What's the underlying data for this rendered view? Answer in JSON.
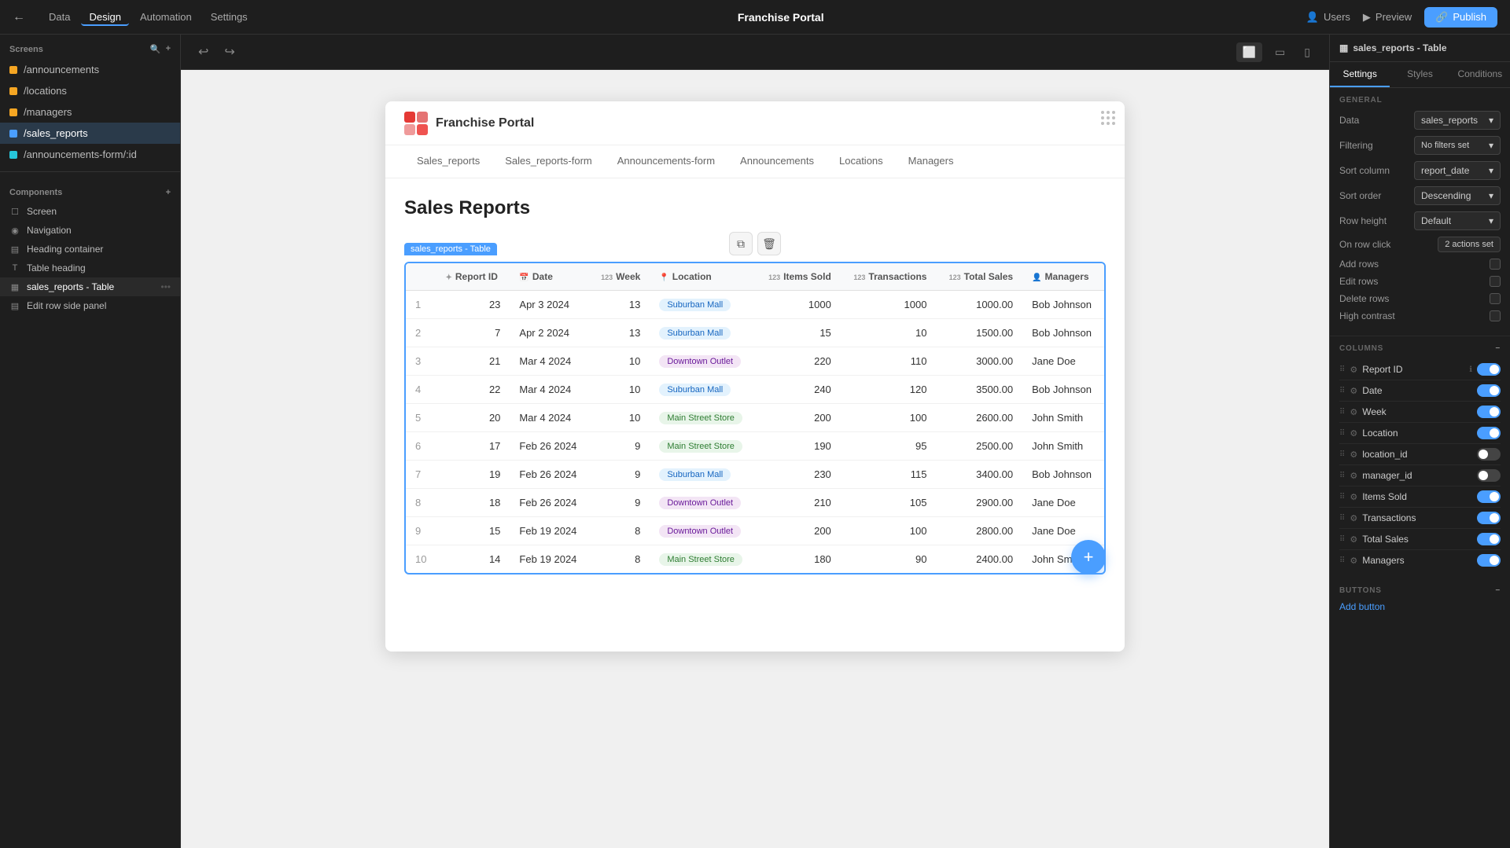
{
  "app": {
    "title": "Franchise Portal",
    "top_nav": [
      "Data",
      "Design",
      "Automation",
      "Settings"
    ],
    "active_nav": "Design",
    "topbar_right": [
      "Users",
      "Preview",
      "Publish"
    ]
  },
  "sidebar": {
    "screens_label": "Screens",
    "screens": [
      {
        "path": "/announcements",
        "color": "orange"
      },
      {
        "path": "/locations",
        "color": "orange"
      },
      {
        "path": "/managers",
        "color": "orange"
      },
      {
        "path": "/sales_reports",
        "color": "blue",
        "active": true
      },
      {
        "path": "/announcements-form/:id",
        "color": "teal"
      }
    ],
    "components_label": "Components",
    "components": [
      {
        "label": "Screen",
        "icon": "☐"
      },
      {
        "label": "Navigation",
        "icon": "◉"
      },
      {
        "label": "Heading container",
        "icon": "▤"
      },
      {
        "label": "Table heading",
        "icon": "T"
      },
      {
        "label": "sales_reports - Table",
        "icon": "▦",
        "active": true
      },
      {
        "label": "Edit row side panel",
        "icon": "▤"
      }
    ]
  },
  "canvas": {
    "undo_label": "↩",
    "redo_label": "↪",
    "devices": [
      "desktop",
      "tablet",
      "mobile"
    ]
  },
  "preview": {
    "logo_text": "Franchise Portal",
    "nav_items": [
      "Sales_reports",
      "Sales_reports-form",
      "Announcements-form",
      "Announcements",
      "Locations",
      "Managers"
    ],
    "page_title": "Sales Reports",
    "table_label": "sales_reports - Table",
    "table_columns": [
      {
        "key": "report_id",
        "label": "Report ID",
        "icon": "✦",
        "type": "id"
      },
      {
        "key": "date",
        "label": "Date",
        "icon": "📅",
        "type": "date"
      },
      {
        "key": "week",
        "label": "Week",
        "icon": "123",
        "type": "num"
      },
      {
        "key": "location",
        "label": "Location",
        "icon": "📍",
        "type": "badge"
      },
      {
        "key": "items_sold",
        "label": "Items Sold",
        "icon": "123",
        "type": "num"
      },
      {
        "key": "transactions",
        "label": "Transactions",
        "icon": "123",
        "type": "num"
      },
      {
        "key": "total_sales",
        "label": "Total Sales",
        "icon": "123",
        "type": "num"
      },
      {
        "key": "managers",
        "label": "Managers",
        "icon": "👤",
        "type": "text"
      }
    ],
    "table_rows": [
      {
        "row": "1",
        "report_id": "23",
        "date": "Apr 3 2024",
        "week": "13",
        "location": "Suburban Mall",
        "location_type": "blue",
        "items_sold": "1000",
        "transactions": "1000",
        "total_sales": "1000.00",
        "manager": "Bob Johnson"
      },
      {
        "row": "2",
        "report_id": "7",
        "date": "Apr 2 2024",
        "week": "13",
        "location": "Suburban Mall",
        "location_type": "blue",
        "items_sold": "15",
        "transactions": "10",
        "total_sales": "1500.00",
        "manager": "Bob Johnson"
      },
      {
        "row": "3",
        "report_id": "21",
        "date": "Mar 4 2024",
        "week": "10",
        "location": "Downtown Outlet",
        "location_type": "purple",
        "items_sold": "220",
        "transactions": "110",
        "total_sales": "3000.00",
        "manager": "Jane Doe"
      },
      {
        "row": "4",
        "report_id": "22",
        "date": "Mar 4 2024",
        "week": "10",
        "location": "Suburban Mall",
        "location_type": "blue",
        "items_sold": "240",
        "transactions": "120",
        "total_sales": "3500.00",
        "manager": "Bob Johnson"
      },
      {
        "row": "5",
        "report_id": "20",
        "date": "Mar 4 2024",
        "week": "10",
        "location": "Main Street Store",
        "location_type": "green",
        "items_sold": "200",
        "transactions": "100",
        "total_sales": "2600.00",
        "manager": "John Smith"
      },
      {
        "row": "6",
        "report_id": "17",
        "date": "Feb 26 2024",
        "week": "9",
        "location": "Main Street Store",
        "location_type": "green",
        "items_sold": "190",
        "transactions": "95",
        "total_sales": "2500.00",
        "manager": "John Smith"
      },
      {
        "row": "7",
        "report_id": "19",
        "date": "Feb 26 2024",
        "week": "9",
        "location": "Suburban Mall",
        "location_type": "blue",
        "items_sold": "230",
        "transactions": "115",
        "total_sales": "3400.00",
        "manager": "Bob Johnson"
      },
      {
        "row": "8",
        "report_id": "18",
        "date": "Feb 26 2024",
        "week": "9",
        "location": "Downtown Outlet",
        "location_type": "purple",
        "items_sold": "210",
        "transactions": "105",
        "total_sales": "2900.00",
        "manager": "Jane Doe"
      },
      {
        "row": "9",
        "report_id": "15",
        "date": "Feb 19 2024",
        "week": "8",
        "location": "Downtown Outlet",
        "location_type": "purple",
        "items_sold": "200",
        "transactions": "100",
        "total_sales": "2800.00",
        "manager": "Jane Doe"
      },
      {
        "row": "10",
        "report_id": "14",
        "date": "Feb 19 2024",
        "week": "8",
        "location": "Main Street Store",
        "location_type": "green",
        "items_sold": "180",
        "transactions": "90",
        "total_sales": "2400.00",
        "manager": "John Smith"
      }
    ],
    "fab_label": "+"
  },
  "right_panel": {
    "header_label": "sales_reports - Table",
    "tabs": [
      "Settings",
      "Styles",
      "Conditions"
    ],
    "active_tab": "Settings",
    "general": {
      "title": "GENERAL",
      "data_label": "Data",
      "data_value": "sales_reports",
      "filtering_label": "Filtering",
      "filtering_value": "No filters set",
      "sort_column_label": "Sort column",
      "sort_column_value": "report_date",
      "sort_order_label": "Sort order",
      "sort_order_value": "Descending",
      "row_height_label": "Row height",
      "row_height_value": "Default",
      "on_row_click_label": "On row click",
      "on_row_click_value": "2 actions set",
      "add_rows_label": "Add rows",
      "edit_rows_label": "Edit rows",
      "delete_rows_label": "Delete rows",
      "high_contrast_label": "High contrast"
    },
    "columns": {
      "title": "COLUMNS",
      "items": [
        {
          "name": "Report ID",
          "enabled": true,
          "has_info": true
        },
        {
          "name": "Date",
          "enabled": true,
          "has_info": false
        },
        {
          "name": "Week",
          "enabled": true,
          "has_info": false
        },
        {
          "name": "Location",
          "enabled": true,
          "has_info": false
        },
        {
          "name": "location_id",
          "enabled": false,
          "has_info": false
        },
        {
          "name": "manager_id",
          "enabled": false,
          "has_info": false
        },
        {
          "name": "Items Sold",
          "enabled": true,
          "has_info": false
        },
        {
          "name": "Transactions",
          "enabled": true,
          "has_info": false
        },
        {
          "name": "Total Sales",
          "enabled": true,
          "has_info": false
        },
        {
          "name": "Managers",
          "enabled": true,
          "has_info": false
        }
      ]
    },
    "buttons": {
      "title": "BUTTONS",
      "add_button_label": "Add button"
    }
  }
}
